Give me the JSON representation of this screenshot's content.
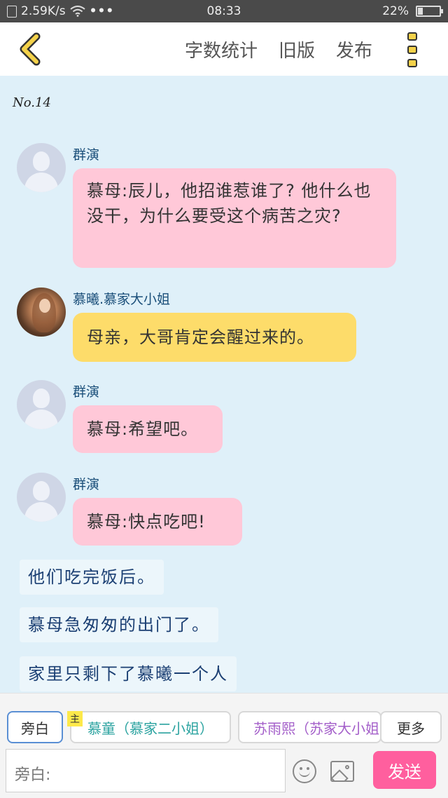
{
  "status_bar": {
    "speed": "2.59K/s",
    "dots": "•••",
    "time": "08:33",
    "battery_text": "22%",
    "battery_level": 0.22
  },
  "header": {
    "back_icon": "chevron-left-icon",
    "word_count": "字数统计",
    "old_version": "旧版",
    "publish": "发布",
    "more_icon": "vertical-dots-icon"
  },
  "chapter": "No.14",
  "messages": [
    {
      "name": "群演",
      "text": "慕母:辰儿，他招谁惹谁了? 他什么也没干，为什么要受这个病苦之灾?",
      "color": "#ffc8d8"
    },
    {
      "name": "慕曦.慕家大小姐",
      "text": "母亲，大哥肯定会醒过来的。",
      "color": "#fddc6a"
    },
    {
      "name": "群演",
      "text": "慕母:希望吧。",
      "color": "#ffc8d8"
    },
    {
      "name": "群演",
      "text": "慕母:快点吃吧!",
      "color": "#ffc8d8"
    }
  ],
  "narration": [
    "他们吃完饭后。",
    "慕母急匆匆的出门了。",
    "家里只剩下了慕曦一个人"
  ],
  "roles": {
    "narrator": "旁白",
    "lead_badge": "主",
    "char1": "慕童（慕家二小姐）",
    "char2": "苏雨熙（苏家大小姐",
    "more": "更多"
  },
  "input": {
    "placeholder": "旁白:"
  },
  "send": "发送"
}
